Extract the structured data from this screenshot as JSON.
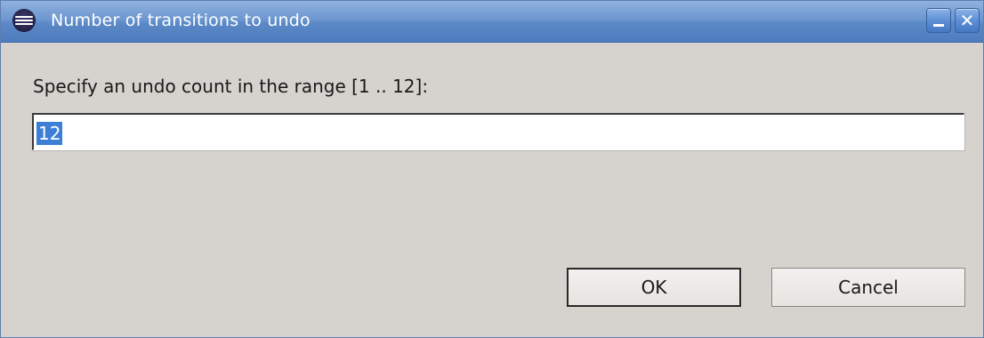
{
  "window": {
    "title": "Number of transitions to undo",
    "title_icon": "eclipse-app-icon",
    "controls": {
      "minimize_icon": "minimize-icon",
      "close_icon": "close-icon",
      "close_glyph": "✕"
    }
  },
  "dialog": {
    "prompt": "Specify an undo count in the range [1 .. 12]:",
    "input_value": "12",
    "input_selected": true,
    "buttons": {
      "ok_label": "OK",
      "cancel_label": "Cancel"
    }
  },
  "colors": {
    "titlebar": "#5b88c6",
    "dialog_background": "#d6d2ce",
    "selection_highlight": "#3d7fd6"
  }
}
